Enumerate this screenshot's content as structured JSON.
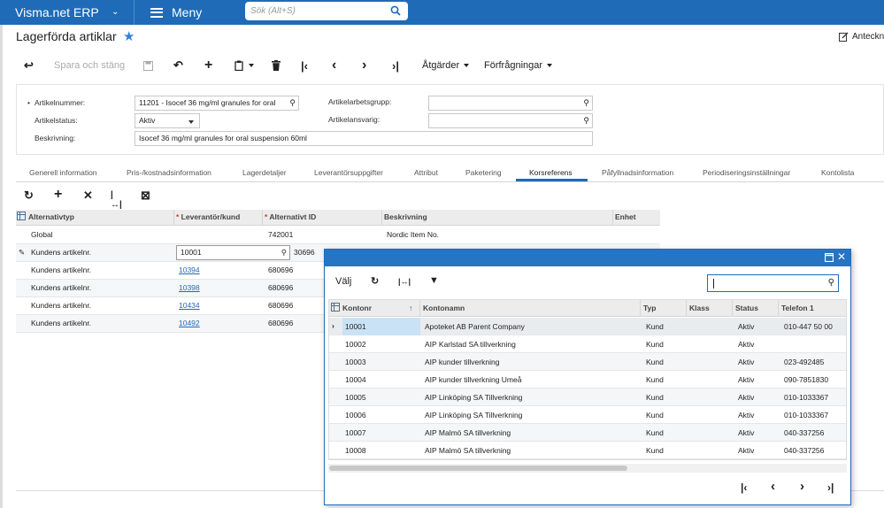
{
  "topbar": {
    "brand": "Visma.net ERP",
    "brand_chevron": "⌄",
    "menu_label": "Meny",
    "search_placeholder": "Sök (Alt+S)"
  },
  "page": {
    "title": "Lagerförda artiklar",
    "star": "★",
    "notes_label": "Anteckn"
  },
  "toolbar": {
    "back": "↩",
    "save_close": "Spara och stäng",
    "save": "💾",
    "undo": "↶",
    "add": "+",
    "copy_paste": "📋",
    "delete": "🗑",
    "first": "|‹",
    "prev": "‹",
    "next": "›",
    "last": "›|",
    "actions": "Åtgärder",
    "inquiries": "Förfrågningar"
  },
  "form": {
    "item_no_label": "Artikelnummer:",
    "item_no_value": "11201 - Isocef 36 mg/ml  granules for oral",
    "item_status_label": "Artikelstatus:",
    "item_status_value": "Aktiv",
    "description_label": "Beskrivning:",
    "description_value": "Isocef 36 mg/ml  granules for oral suspension 60ml",
    "work_group_label": "Artikelarbetsgrupp:",
    "work_group_value": "",
    "responsible_label": "Artikelansvarig:",
    "responsible_value": ""
  },
  "tabs": [
    {
      "label": "Generell information"
    },
    {
      "label": "Pris-/kostnadsinformation"
    },
    {
      "label": "Lagerdetaljer"
    },
    {
      "label": "Leverantörsuppgifter"
    },
    {
      "label": "Attribut"
    },
    {
      "label": "Paketering"
    },
    {
      "label": "Korsreferens"
    },
    {
      "label": "Påfyllnadsinformation"
    },
    {
      "label": "Periodiseringsinställningar"
    },
    {
      "label": "Kontolista"
    }
  ],
  "active_tab": "Korsreferens",
  "grid_toolbar": {
    "refresh": "↻",
    "add": "+",
    "remove": "✕",
    "fit": "|↔|",
    "export": "⊠"
  },
  "grid": {
    "headers": {
      "alt_type": "Alternativtyp",
      "supplier": "Leverantör/kund",
      "alt_id": "Alternativt ID",
      "description": "Beskrivning",
      "unit": "Enhet"
    },
    "rows": [
      {
        "type": "Global",
        "supplier": "",
        "alt_id": "742001",
        "description": "Nordic Item No."
      },
      {
        "type": "Kundens artikelnr.",
        "supplier": "10001",
        "alt_id": "30696",
        "description": ""
      },
      {
        "type": "Kundens artikelnr.",
        "supplier": "10394",
        "alt_id": "680696",
        "description": ""
      },
      {
        "type": "Kundens artikelnr.",
        "supplier": "10398",
        "alt_id": "680696",
        "description": ""
      },
      {
        "type": "Kundens artikelnr.",
        "supplier": "10434",
        "alt_id": "680696",
        "description": ""
      },
      {
        "type": "Kundens artikelnr.",
        "supplier": "10492",
        "alt_id": "680696",
        "description": ""
      }
    ]
  },
  "popup": {
    "select_label": "Välj",
    "refresh": "↻",
    "fit": "|↔|",
    "filter": "▼",
    "search_value": "",
    "headers": {
      "account_no": "Kontonr",
      "account_name": "Kontonamn",
      "type": "Typ",
      "class": "Klass",
      "status": "Status",
      "phone": "Telefon 1"
    },
    "rows": [
      {
        "no": "10001",
        "name": "Apoteket AB Parent Company",
        "type": "Kund",
        "class": "",
        "status": "Aktiv",
        "phone": "010-447 50 00"
      },
      {
        "no": "10002",
        "name": "AIP Karlstad SA tillverkning",
        "type": "Kund",
        "class": "",
        "status": "Aktiv",
        "phone": ""
      },
      {
        "no": "10003",
        "name": "AIP kunder tillverkning",
        "type": "Kund",
        "class": "",
        "status": "Aktiv",
        "phone": "023-492485"
      },
      {
        "no": "10004",
        "name": "AIP kunder tillverkning Umeå",
        "type": "Kund",
        "class": "",
        "status": "Aktiv",
        "phone": "090-7851830"
      },
      {
        "no": "10005",
        "name": "AIP Linköping SA Tillverkning",
        "type": "Kund",
        "class": "",
        "status": "Aktiv",
        "phone": "010-1033367"
      },
      {
        "no": "10006",
        "name": "AIP Linköping SA Tillverkning",
        "type": "Kund",
        "class": "",
        "status": "Aktiv",
        "phone": "010-1033367"
      },
      {
        "no": "10007",
        "name": "AIP Malmö SA tillverkning",
        "type": "Kund",
        "class": "",
        "status": "Aktiv",
        "phone": "040-337256"
      },
      {
        "no": "10008",
        "name": "AIP Malmö SA tillverkning",
        "type": "Kund",
        "class": "",
        "status": "Aktiv",
        "phone": "040-337256"
      }
    ],
    "nav": {
      "first": "|‹",
      "prev": "‹",
      "next": "›",
      "last": "›|"
    }
  },
  "colors": {
    "brand_blue": "#1f6bb7",
    "popup_header": "#2575c4",
    "link": "#1f6bb7",
    "selected_cell": "#c9e2f5"
  }
}
